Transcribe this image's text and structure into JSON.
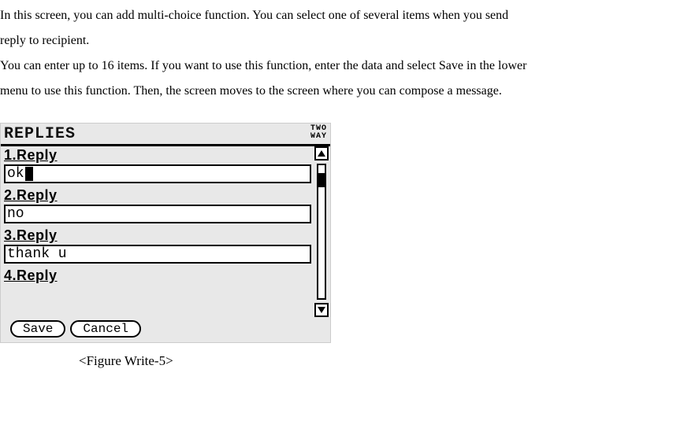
{
  "intro": {
    "p1a": "In this screen, you can add multi-choice function. You can select one of several items when you send",
    "p1b": "reply to recipient.",
    "p2a": "You can enter up to 16 items. If you want to use this function, enter the data and select Save in the lower",
    "p2b": "menu to use this function. Then, the screen moves to the screen where you can compose a message."
  },
  "screen": {
    "title": "REPLIES",
    "mode_line1": "TWO",
    "mode_line2": "WAY",
    "replies": [
      {
        "label": "1.Reply",
        "value": "ok",
        "has_caret": true
      },
      {
        "label": "2.Reply",
        "value": "no",
        "has_caret": false
      },
      {
        "label": "3.Reply",
        "value": "thank u",
        "has_caret": false
      },
      {
        "label": "4.Reply",
        "value": "",
        "has_caret": false
      }
    ],
    "buttons": {
      "save": "Save",
      "cancel": "Cancel"
    }
  },
  "caption": "<Figure Write-5>"
}
